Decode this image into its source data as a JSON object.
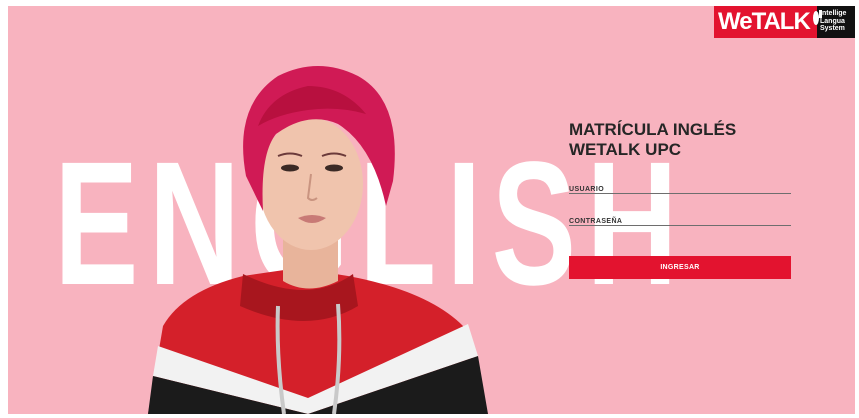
{
  "logo": {
    "brand": "WeTALK",
    "tagline": [
      "Intellige",
      "Langua",
      "System"
    ]
  },
  "hero": {
    "big_word": "ENGLISH"
  },
  "form": {
    "title_line1": "MATRÍCULA INGLÉS",
    "title_line2": "WETALK UPC",
    "username_label": "USUARIO",
    "password_label": "CONTRASEÑA",
    "submit_label": "INGRESAR"
  },
  "colors": {
    "background": "#f8b3bf",
    "accent": "#e3132f"
  }
}
